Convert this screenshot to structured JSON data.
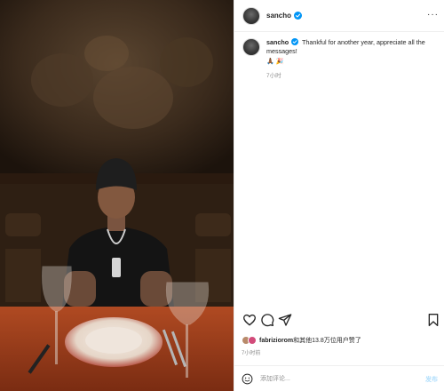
{
  "post": {
    "username": "sancho",
    "caption_username": "sancho",
    "caption_text": "Thankful for another year, appreciate all the messages!",
    "caption_emoji": "🙏🏾 🎉",
    "caption_time": "7小时",
    "likes_user": "fabriziorom",
    "likes_rest": "和其他13.8万位用户赞了",
    "post_time": "7小时前"
  },
  "comment": {
    "placeholder": "添加评论...",
    "post_label": "发布"
  },
  "icons": {
    "like": "heart-icon",
    "comment": "comment-icon",
    "share": "share-icon",
    "save": "bookmark-icon",
    "emoji": "smiley-icon",
    "verified": "verified-badge-icon",
    "more": "more-options-icon"
  },
  "colors": {
    "verified": "#0095f6",
    "secondary_text": "#8e8e8e",
    "post_button": "#b2dffc"
  }
}
